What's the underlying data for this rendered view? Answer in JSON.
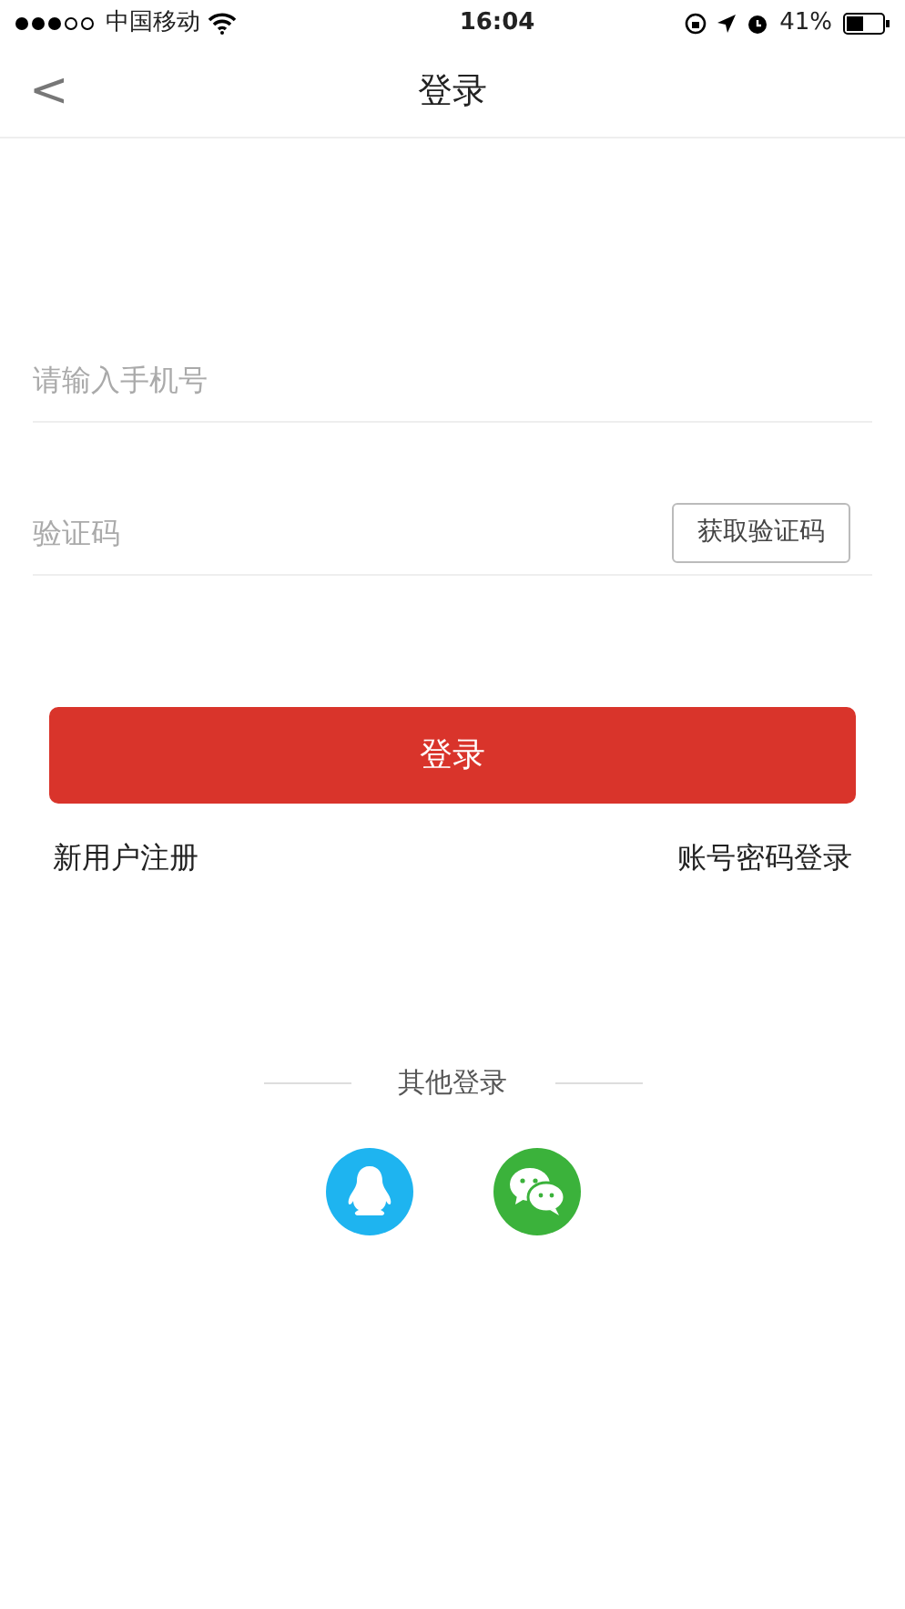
{
  "status_bar": {
    "carrier": "中国移动",
    "time": "16:04",
    "battery": "41%"
  },
  "header": {
    "back": "<",
    "title": "登录"
  },
  "phone_field": {
    "placeholder": "请输入手机号"
  },
  "code_field": {
    "placeholder": "验证码",
    "button": "获取验证码"
  },
  "login_button": "登录",
  "links": [
    "新用户注册",
    "账号密码登录"
  ],
  "other_login": {
    "title": "其他登录",
    "providers": [
      {
        "kind": "qq",
        "color": "#1eb4f0"
      },
      {
        "kind": "wechat",
        "color": "#3bb23b"
      }
    ]
  }
}
